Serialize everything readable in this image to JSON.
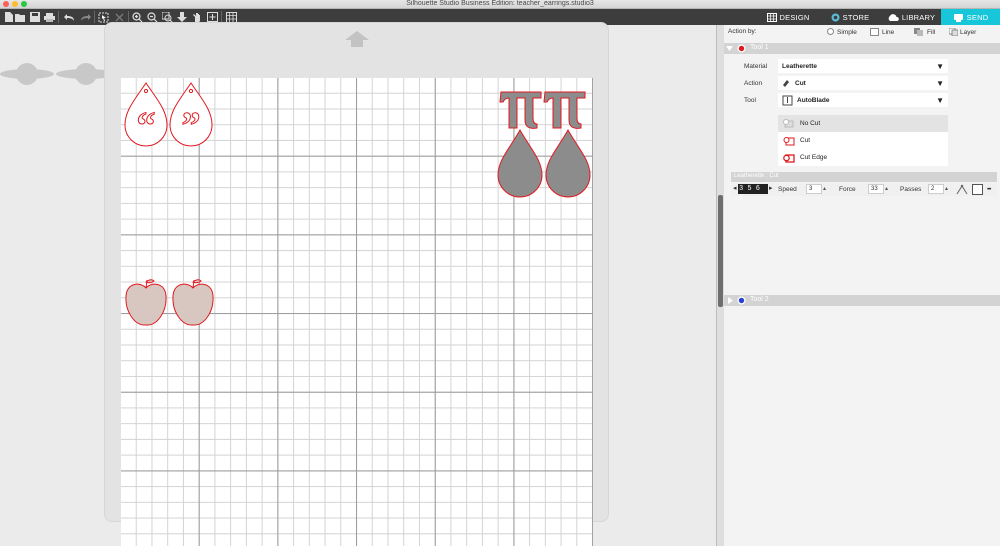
{
  "window": {
    "title": "Silhouette Studio Business Edition: teacher_earrings.studio3"
  },
  "toolbar": {
    "icons": [
      "new-icon",
      "open-icon",
      "save-icon",
      "print-icon",
      "undo-icon",
      "redo-icon",
      "select-icon",
      "delete-icon",
      "zoom-in-icon",
      "zoom-out-icon",
      "zoom-fit-icon",
      "move-down-icon",
      "pan-icon",
      "add-page-icon",
      "grid-icon"
    ]
  },
  "tabs": [
    {
      "label": "DESIGN",
      "icon": "grid-icon",
      "active": false
    },
    {
      "label": "STORE",
      "icon": "store-icon",
      "active": false
    },
    {
      "label": "LIBRARY",
      "icon": "cloud-icon",
      "active": false
    },
    {
      "label": "SEND",
      "icon": "send-icon",
      "active": true
    }
  ],
  "colors": {
    "toolbar": "#3d3d3d",
    "send_active": "#18c6d9",
    "cut_red": "#e0191f",
    "fill_gray": "#8c8c8c",
    "apple_fill": "#d8c7c1"
  },
  "panel": {
    "action_by_label": "Action by:",
    "modes": [
      {
        "label": "Simple",
        "selected": true
      },
      {
        "label": "Line",
        "selected": false
      },
      {
        "label": "Fill",
        "selected": false
      },
      {
        "label": "Layer",
        "selected": false
      }
    ],
    "tool1": {
      "title": "Tool 1",
      "material_label": "Material",
      "material_value": "Leatherette",
      "action_label": "Action",
      "action_value": "Cut",
      "tool_label": "Tool",
      "tool_value": "AutoBlade",
      "actions": [
        {
          "label": "No Cut",
          "selected": true
        },
        {
          "label": "Cut",
          "selected": false
        },
        {
          "label": "Cut Edge",
          "selected": false
        }
      ],
      "settings_title": "Leatherette : Cut",
      "blade": "3 5 6 7",
      "speed_label": "Speed",
      "speed_value": "3",
      "force_label": "Force",
      "force_value": "33",
      "passes_label": "Passes",
      "passes_value": "2"
    },
    "tool2": {
      "title": "Tool 2"
    }
  }
}
